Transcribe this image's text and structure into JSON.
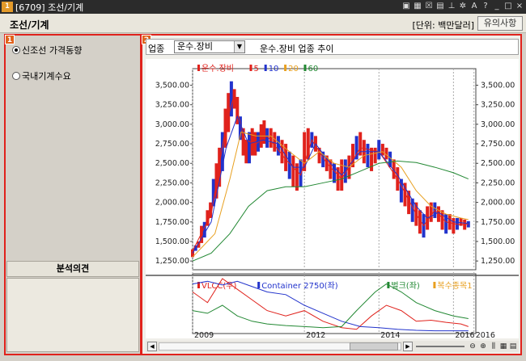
{
  "window": {
    "title": "[6709] 조선/기계",
    "app_badge": "1",
    "icons": [
      "save-icon",
      "keyboard-icon",
      "close-box-icon",
      "image-icon",
      "pin-icon",
      "settings-icon",
      "font-icon",
      "help-icon",
      "minimize-icon",
      "maximize-icon",
      "close-icon"
    ]
  },
  "header": {
    "title": "조선/기계",
    "unit": "[단위: 백만달러]",
    "notice_button": "유의사항"
  },
  "left": {
    "badge": "1",
    "options": [
      {
        "label": "신조선 가격동향",
        "selected": true
      },
      {
        "label": "국내기계수요",
        "selected": false
      }
    ],
    "opinion_title": "분석의견"
  },
  "right": {
    "badge": "2",
    "sector_label": "업종",
    "sector_value": "운수.장비",
    "trend_title": "운수.장비 업종 추이"
  },
  "chart_data": [
    {
      "type": "line",
      "title": "",
      "legend": [
        {
          "name": "운수.장비",
          "color": "#e0221c"
        },
        {
          "name": "5",
          "color": "#e0221c"
        },
        {
          "name": "10",
          "color": "#2233cc"
        },
        {
          "name": "20",
          "color": "#e8a020"
        },
        {
          "name": "60",
          "color": "#228833"
        }
      ],
      "y_ticks": [
        "3,500.00",
        "3,250.00",
        "3,000.00",
        "2,750.00",
        "2,500.00",
        "2,250.00",
        "2,000.00",
        "1,750.00",
        "1,500.00",
        "1,250.00"
      ],
      "ylim": [
        1200,
        3650
      ],
      "x_range": [
        2009.0,
        2016.6
      ],
      "candles": [
        [
          2009.0,
          1300,
          1400
        ],
        [
          2009.08,
          1380,
          1450
        ],
        [
          2009.16,
          1420,
          1500
        ],
        [
          2009.24,
          1480,
          1700
        ],
        [
          2009.32,
          1550,
          1750
        ],
        [
          2009.4,
          1700,
          1900
        ],
        [
          2009.48,
          1800,
          2000
        ],
        [
          2009.56,
          1950,
          2300
        ],
        [
          2009.64,
          2050,
          2500
        ],
        [
          2009.72,
          2200,
          2700
        ],
        [
          2009.8,
          2400,
          2900
        ],
        [
          2009.88,
          2700,
          3200
        ],
        [
          2009.96,
          2900,
          3400
        ],
        [
          2010.04,
          3100,
          3550
        ],
        [
          2010.12,
          3200,
          3450
        ],
        [
          2010.2,
          3000,
          3350
        ],
        [
          2010.28,
          2800,
          3100
        ],
        [
          2010.36,
          2600,
          2950
        ],
        [
          2010.44,
          2500,
          2800
        ],
        [
          2010.52,
          2500,
          2900
        ],
        [
          2010.6,
          2600,
          2950
        ],
        [
          2010.68,
          2600,
          2900
        ],
        [
          2010.76,
          2650,
          2900
        ],
        [
          2010.84,
          2700,
          3000
        ],
        [
          2010.92,
          2750,
          3050
        ],
        [
          2011.0,
          2700,
          2950
        ],
        [
          2011.1,
          2700,
          2950
        ],
        [
          2011.2,
          2650,
          2900
        ],
        [
          2011.3,
          2600,
          2850
        ],
        [
          2011.4,
          2500,
          2800
        ],
        [
          2011.5,
          2400,
          2750
        ],
        [
          2011.6,
          2300,
          2650
        ],
        [
          2011.7,
          2200,
          2600
        ],
        [
          2011.8,
          2150,
          2500
        ],
        [
          2011.9,
          2200,
          2550
        ],
        [
          2012.0,
          2400,
          2900
        ],
        [
          2012.1,
          2550,
          2950
        ],
        [
          2012.2,
          2700,
          2900
        ],
        [
          2012.3,
          2650,
          2850
        ],
        [
          2012.4,
          2500,
          2700
        ],
        [
          2012.5,
          2450,
          2650
        ],
        [
          2012.6,
          2400,
          2600
        ],
        [
          2012.7,
          2300,
          2550
        ],
        [
          2012.8,
          2250,
          2500
        ],
        [
          2012.9,
          2150,
          2450
        ],
        [
          2013.0,
          2150,
          2550
        ],
        [
          2013.1,
          2250,
          2550
        ],
        [
          2013.2,
          2300,
          2600
        ],
        [
          2013.3,
          2450,
          2750
        ],
        [
          2013.4,
          2550,
          2850
        ],
        [
          2013.5,
          2600,
          2900
        ],
        [
          2013.6,
          2500,
          2800
        ],
        [
          2013.7,
          2450,
          2750
        ],
        [
          2013.8,
          2400,
          2700
        ],
        [
          2013.9,
          2500,
          2700
        ],
        [
          2014.0,
          2550,
          2800
        ],
        [
          2014.1,
          2600,
          2750
        ],
        [
          2014.2,
          2550,
          2700
        ],
        [
          2014.3,
          2450,
          2650
        ],
        [
          2014.4,
          2300,
          2550
        ],
        [
          2014.5,
          2150,
          2450
        ],
        [
          2014.6,
          2000,
          2300
        ],
        [
          2014.7,
          1950,
          2250
        ],
        [
          2014.8,
          1850,
          2150
        ],
        [
          2014.9,
          1750,
          2050
        ],
        [
          2015.0,
          1700,
          2000
        ],
        [
          2015.1,
          1600,
          1900
        ],
        [
          2015.2,
          1550,
          1850
        ],
        [
          2015.3,
          1650,
          1950
        ],
        [
          2015.4,
          1750,
          2000
        ],
        [
          2015.5,
          1800,
          2000
        ],
        [
          2015.6,
          1750,
          1950
        ],
        [
          2015.7,
          1650,
          1900
        ],
        [
          2015.8,
          1600,
          1850
        ],
        [
          2015.9,
          1650,
          1850
        ],
        [
          2016.0,
          1600,
          1800
        ],
        [
          2016.1,
          1650,
          1800
        ],
        [
          2016.2,
          1700,
          1800
        ],
        [
          2016.3,
          1650,
          1780
        ],
        [
          2016.4,
          1680,
          1760
        ]
      ],
      "series": [
        {
          "name": "5",
          "color": "#e0221c",
          "points": [
            [
              2009.0,
              1380
            ],
            [
              2009.5,
              1850
            ],
            [
              2009.9,
              3000
            ],
            [
              2010.1,
              3350
            ],
            [
              2010.4,
              2800
            ],
            [
              2010.7,
              2750
            ],
            [
              2011.0,
              2850
            ],
            [
              2011.5,
              2550
            ],
            [
              2011.9,
              2350
            ],
            [
              2012.2,
              2800
            ],
            [
              2012.6,
              2500
            ],
            [
              2013.0,
              2300
            ],
            [
              2013.5,
              2700
            ],
            [
              2014.0,
              2650
            ],
            [
              2014.5,
              2300
            ],
            [
              2015.0,
              1850
            ],
            [
              2015.2,
              1700
            ],
            [
              2015.5,
              1900
            ],
            [
              2015.8,
              1750
            ],
            [
              2016.1,
              1720
            ],
            [
              2016.4,
              1720
            ]
          ]
        },
        {
          "name": "10",
          "color": "#2233cc",
          "points": [
            [
              2009.0,
              1350
            ],
            [
              2009.5,
              1750
            ],
            [
              2009.9,
              2700
            ],
            [
              2010.2,
              3100
            ],
            [
              2010.5,
              2750
            ],
            [
              2010.9,
              2800
            ],
            [
              2011.3,
              2750
            ],
            [
              2011.7,
              2450
            ],
            [
              2012.0,
              2450
            ],
            [
              2012.3,
              2750
            ],
            [
              2012.7,
              2500
            ],
            [
              2013.0,
              2350
            ],
            [
              2013.5,
              2650
            ],
            [
              2014.0,
              2650
            ],
            [
              2014.5,
              2350
            ],
            [
              2015.0,
              1950
            ],
            [
              2015.3,
              1800
            ],
            [
              2015.6,
              1870
            ],
            [
              2016.0,
              1750
            ],
            [
              2016.4,
              1730
            ]
          ]
        },
        {
          "name": "20",
          "color": "#e8a020",
          "points": [
            [
              2009.0,
              1300
            ],
            [
              2009.6,
              1600
            ],
            [
              2010.0,
              2300
            ],
            [
              2010.3,
              2900
            ],
            [
              2010.7,
              2850
            ],
            [
              2011.1,
              2850
            ],
            [
              2011.6,
              2650
            ],
            [
              2012.0,
              2500
            ],
            [
              2012.4,
              2650
            ],
            [
              2012.8,
              2500
            ],
            [
              2013.2,
              2450
            ],
            [
              2013.6,
              2600
            ],
            [
              2014.1,
              2650
            ],
            [
              2014.6,
              2450
            ],
            [
              2015.0,
              2150
            ],
            [
              2015.4,
              1950
            ],
            [
              2015.8,
              1850
            ],
            [
              2016.2,
              1800
            ],
            [
              2016.4,
              1780
            ]
          ]
        },
        {
          "name": "60",
          "color": "#228833",
          "points": [
            [
              2009.0,
              1250
            ],
            [
              2009.5,
              1350
            ],
            [
              2010.0,
              1600
            ],
            [
              2010.5,
              1950
            ],
            [
              2011.0,
              2150
            ],
            [
              2011.5,
              2200
            ],
            [
              2012.0,
              2200
            ],
            [
              2012.5,
              2250
            ],
            [
              2013.0,
              2300
            ],
            [
              2013.5,
              2400
            ],
            [
              2014.0,
              2500
            ],
            [
              2014.5,
              2530
            ],
            [
              2015.0,
              2510
            ],
            [
              2015.5,
              2450
            ],
            [
              2016.0,
              2380
            ],
            [
              2016.4,
              2300
            ]
          ]
        }
      ]
    },
    {
      "type": "line",
      "title": "",
      "legend": [
        {
          "name": "VLCC(우)",
          "color": "#e0221c"
        },
        {
          "name": "Container 2750(좌)",
          "color": "#2233cc"
        },
        {
          "name": "벌크(좌)",
          "color": "#228833"
        },
        {
          "name": "복수종목1",
          "color": "#e8a020"
        }
      ],
      "x_ticks": [
        "2009",
        "2012",
        "2014",
        "2016",
        "2016"
      ],
      "x_range": [
        2009.0,
        2016.6
      ],
      "ylim": [
        0,
        100
      ],
      "series": [
        {
          "name": "VLCC(우)",
          "color": "#e0221c",
          "points": [
            [
              2009.0,
              75
            ],
            [
              2009.4,
              55
            ],
            [
              2009.8,
              100
            ],
            [
              2010.2,
              80
            ],
            [
              2010.6,
              60
            ],
            [
              2011.0,
              40
            ],
            [
              2011.5,
              30
            ],
            [
              2012.0,
              40
            ],
            [
              2012.5,
              20
            ],
            [
              2013.0,
              8
            ],
            [
              2013.4,
              5
            ],
            [
              2013.8,
              30
            ],
            [
              2014.2,
              50
            ],
            [
              2014.6,
              40
            ],
            [
              2015.0,
              20
            ],
            [
              2015.4,
              22
            ],
            [
              2015.8,
              18
            ],
            [
              2016.2,
              15
            ],
            [
              2016.4,
              10
            ]
          ]
        },
        {
          "name": "Container 2750(좌)",
          "color": "#2233cc",
          "points": [
            [
              2009.0,
              90
            ],
            [
              2009.4,
              95
            ],
            [
              2009.8,
              88
            ],
            [
              2010.2,
              95
            ],
            [
              2010.6,
              85
            ],
            [
              2011.0,
              75
            ],
            [
              2011.5,
              70
            ],
            [
              2012.0,
              50
            ],
            [
              2012.5,
              35
            ],
            [
              2013.0,
              20
            ],
            [
              2013.5,
              10
            ],
            [
              2014.0,
              8
            ],
            [
              2014.5,
              5
            ],
            [
              2015.0,
              3
            ],
            [
              2015.5,
              2
            ],
            [
              2016.0,
              2
            ],
            [
              2016.4,
              2
            ]
          ]
        },
        {
          "name": "벌크(좌)",
          "color": "#228833",
          "points": [
            [
              2009.0,
              40
            ],
            [
              2009.4,
              35
            ],
            [
              2009.8,
              50
            ],
            [
              2010.2,
              30
            ],
            [
              2010.6,
              20
            ],
            [
              2011.0,
              15
            ],
            [
              2011.5,
              12
            ],
            [
              2012.0,
              10
            ],
            [
              2012.5,
              8
            ],
            [
              2013.0,
              10
            ],
            [
              2013.4,
              40
            ],
            [
              2013.9,
              75
            ],
            [
              2014.2,
              90
            ],
            [
              2014.6,
              75
            ],
            [
              2015.0,
              55
            ],
            [
              2015.5,
              40
            ],
            [
              2016.0,
              30
            ],
            [
              2016.4,
              25
            ]
          ]
        }
      ]
    }
  ],
  "scroll": {
    "left_arrow": "◀",
    "right_arrow": "▶"
  },
  "tools": [
    "zoom-out-icon",
    "zoom-in-icon",
    "bars-icon",
    "grid-icon",
    "print-icon"
  ]
}
